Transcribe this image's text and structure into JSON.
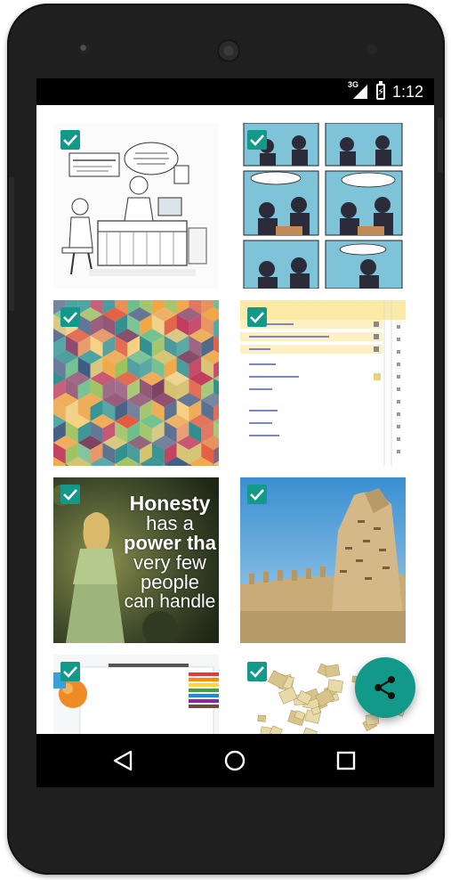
{
  "device": {
    "frame_color": "#1f1f1f",
    "screen_bg": "#ffffff"
  },
  "status_bar": {
    "network": "3G",
    "time": "1:12",
    "icons": [
      "signal-icon",
      "battery-charging-icon"
    ]
  },
  "gallery": {
    "accent_color": "#13998a",
    "items": [
      {
        "name": "data-dollar-cartoon",
        "selected": true
      },
      {
        "name": "office-comic-strip",
        "selected": true
      },
      {
        "name": "colorful-hexagon-pattern",
        "selected": true
      },
      {
        "name": "spreadsheet-list",
        "selected": true
      },
      {
        "name": "honesty-quote",
        "selected": true,
        "quote_lines": [
          "Honesty",
          "has a",
          "power tha",
          "very few",
          "people",
          "can handle"
        ]
      },
      {
        "name": "mud-mosque",
        "selected": true
      },
      {
        "name": "pencils-page",
        "selected": true
      },
      {
        "name": "scattered-tiles",
        "selected": true
      }
    ]
  },
  "fab": {
    "icon": "share-icon",
    "color": "#13998a"
  },
  "nav_bar": {
    "buttons": [
      "back-icon",
      "home-icon",
      "recents-icon"
    ]
  }
}
